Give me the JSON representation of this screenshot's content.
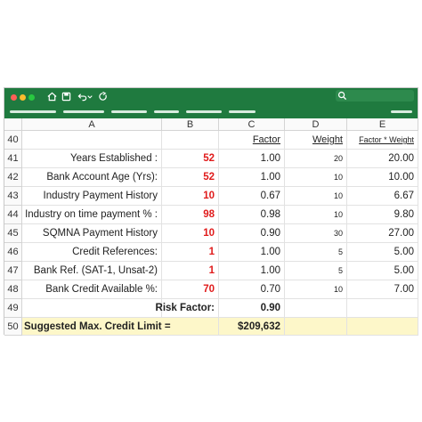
{
  "toolbar": {
    "search_placeholder": ""
  },
  "columns": [
    "A",
    "B",
    "C",
    "D",
    "E"
  ],
  "rows": [
    {
      "num": "40",
      "a": "",
      "b": "",
      "c": "Factor",
      "d": "Weight",
      "e": "Factor * Weight"
    },
    {
      "num": "41",
      "a": "Years Established :",
      "b": "52",
      "c": "1.00",
      "d": "20",
      "e": "20.00"
    },
    {
      "num": "42",
      "a": "Bank Account Age (Yrs):",
      "b": "52",
      "c": "1.00",
      "d": "10",
      "e": "10.00"
    },
    {
      "num": "43",
      "a": "Industry Payment History",
      "b": "10",
      "c": "0.67",
      "d": "10",
      "e": "6.67"
    },
    {
      "num": "44",
      "a": "Industry on time payment % :",
      "b": "98",
      "c": "0.98",
      "d": "10",
      "e": "9.80"
    },
    {
      "num": "45",
      "a": "SQMNA Payment History",
      "b": "10",
      "c": "0.90",
      "d": "30",
      "e": "27.00"
    },
    {
      "num": "46",
      "a": "Credit References:",
      "b": "1",
      "c": "1.00",
      "d": "5",
      "e": "5.00"
    },
    {
      "num": "47",
      "a": "Bank Ref. (SAT-1, Unsat-2)",
      "b": "1",
      "c": "1.00",
      "d": "5",
      "e": "5.00"
    },
    {
      "num": "48",
      "a": "Bank Credit Available %:",
      "b": "70",
      "c": "0.70",
      "d": "10",
      "e": "7.00"
    },
    {
      "num": "49",
      "a": "",
      "b": "Risk Factor:",
      "c": "0.90",
      "d": "",
      "e": ""
    },
    {
      "num": "50",
      "a": "Suggested Max. Credit Limit =",
      "b": "",
      "c": "$209,632",
      "d": "",
      "e": ""
    }
  ],
  "colors": {
    "titlebar": "#1f7a3f",
    "value_red": "#e01b1b",
    "highlight": "#fdf7c9"
  },
  "icons": [
    "close-dot",
    "minimize-dot",
    "zoom-dot",
    "home-icon",
    "save-icon",
    "undo-icon",
    "redo-icon",
    "search-icon"
  ]
}
